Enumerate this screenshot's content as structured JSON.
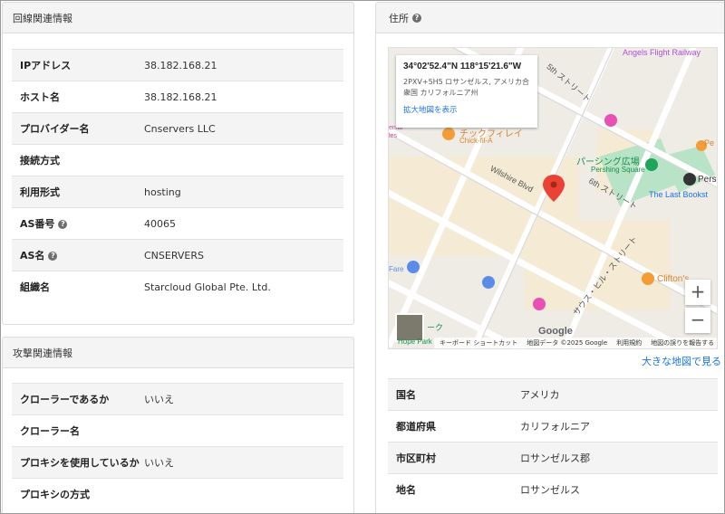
{
  "line_info": {
    "title": "回線関連情報",
    "rows": [
      {
        "label": "IPアドレス",
        "value": "38.182.168.21",
        "help": false
      },
      {
        "label": "ホスト名",
        "value": "38.182.168.21",
        "help": false
      },
      {
        "label": "プロバイダー名",
        "value": "Cnservers LLC",
        "help": false
      },
      {
        "label": "接続方式",
        "value": "",
        "help": false
      },
      {
        "label": "利用形式",
        "value": "hosting",
        "help": false
      },
      {
        "label": "AS番号",
        "value": "40065",
        "help": true
      },
      {
        "label": "AS名",
        "value": "CNSERVERS",
        "help": true
      },
      {
        "label": "組織名",
        "value": "Starcloud Global Pte. Ltd.",
        "help": false
      }
    ]
  },
  "attack_info": {
    "title": "攻撃関連情報",
    "rows": [
      {
        "label": "クローラーであるか",
        "value": "いいえ"
      },
      {
        "label": "クローラー名",
        "value": ""
      },
      {
        "label": "プロキシを使用しているか",
        "value": "いいえ"
      },
      {
        "label": "プロキシの方式",
        "value": ""
      }
    ]
  },
  "address": {
    "title": "住所",
    "map": {
      "coords": "34°02'52.4\"N 118°15'21.6\"W",
      "address_line": "2PXV+5H5 ロサンゼルス, アメリカ合衆国 カリフォルニア州",
      "enlarge_link": "拡大地図を表示",
      "labels": {
        "angels_flight": "Angels Flight Railway",
        "fifth_street": "5th ストリート",
        "chick_fil_a_jp": "チックフィレイ",
        "chick_fil_a": "Chick-fil-A",
        "wilshire": "Wilshire Blvd",
        "sixth_street": "6th ストリート",
        "pershing_jp": "パーシング広場",
        "pershing": "Pershing Square",
        "pershing_station": "Pershi",
        "last_bookstore": "The Last Bookst",
        "south_hill": "サウス・ヒル・ストリート",
        "cliftons": "Clifton's",
        "hope_park_jp": "ーク",
        "hope_park": "Hope Park",
        "google": "Google",
        "pe": "Pe",
        "fare": "Fare",
        "ental": "ental",
        "les": "les"
      },
      "footer": [
        "キーボード ショートカット",
        "地図データ ©2025 Google",
        "利用規約",
        "地図の誤りを報告する"
      ],
      "zoom_in": "+",
      "zoom_out": "−"
    },
    "bigger_map_link": "大きな地図で見る",
    "rows": [
      {
        "label": "国名",
        "value": "アメリカ"
      },
      {
        "label": "都道府県",
        "value": "カリフォルニア"
      },
      {
        "label": "市区町村",
        "value": "ロサンゼルス郡"
      },
      {
        "label": "地名",
        "value": "ロサンゼルス"
      }
    ]
  },
  "colors": {
    "link": "#1a73e8",
    "pin": "#ea4335",
    "park": "#b9e3c6",
    "block": "#f5ead3"
  }
}
